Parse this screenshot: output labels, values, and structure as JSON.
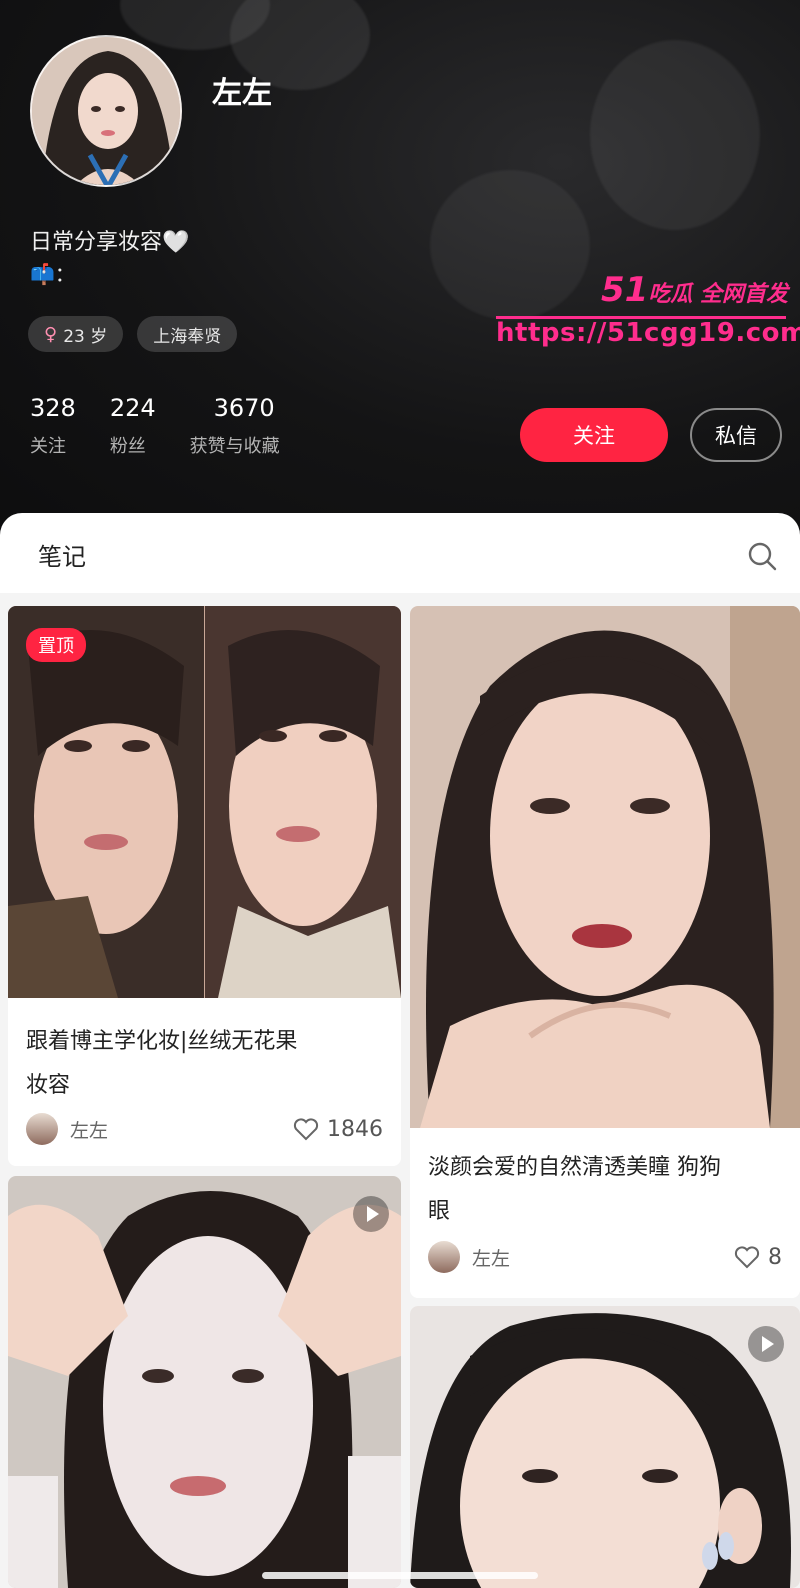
{
  "profile": {
    "name": "左左",
    "bio": "日常分享妆容🤍",
    "bio_line2": "📫：",
    "tags": [
      {
        "icon": "female-icon",
        "label": "23 岁"
      },
      {
        "label": "上海奉贤"
      }
    ],
    "stats": [
      {
        "value": "328",
        "label": "关注"
      },
      {
        "value": "224",
        "label": "粉丝"
      },
      {
        "value": "3670",
        "label": "获赞与收藏"
      }
    ],
    "follow_label": "关注",
    "message_label": "私信"
  },
  "watermark": {
    "num": "51",
    "text": "吃瓜 全网首发",
    "url": "https://51cgg19.com"
  },
  "notes": {
    "title": "笔记"
  },
  "feed": {
    "cards": [
      {
        "badge": "置顶",
        "title_line1": "跟着博主学化妆|丝绒无花果",
        "title_line2": "妆容",
        "author": "左左",
        "likes": "1846"
      },
      {
        "title_line1": "淡颜会爱的自然清透美瞳 狗狗",
        "title_line2": "眼",
        "author": "左左",
        "likes": "8"
      }
    ]
  },
  "colors": {
    "accent": "#ff2442",
    "watermark": "#ff2d8d",
    "header_bg": "#141415"
  }
}
